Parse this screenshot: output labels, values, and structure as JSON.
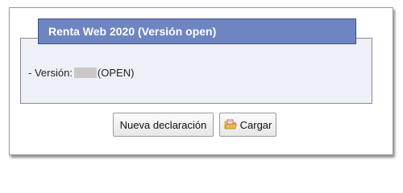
{
  "panel": {
    "title": "Renta Web 2020 (Versión open)",
    "version_label": "- Versión:",
    "version_suffix": "(OPEN)"
  },
  "buttons": {
    "new_label": "Nueva declaración",
    "load_label": "Cargar",
    "load_icon": "open-folder-icon"
  },
  "colors": {
    "title_bar": "#6f85c2",
    "panel_bg": "#eef0f8"
  }
}
